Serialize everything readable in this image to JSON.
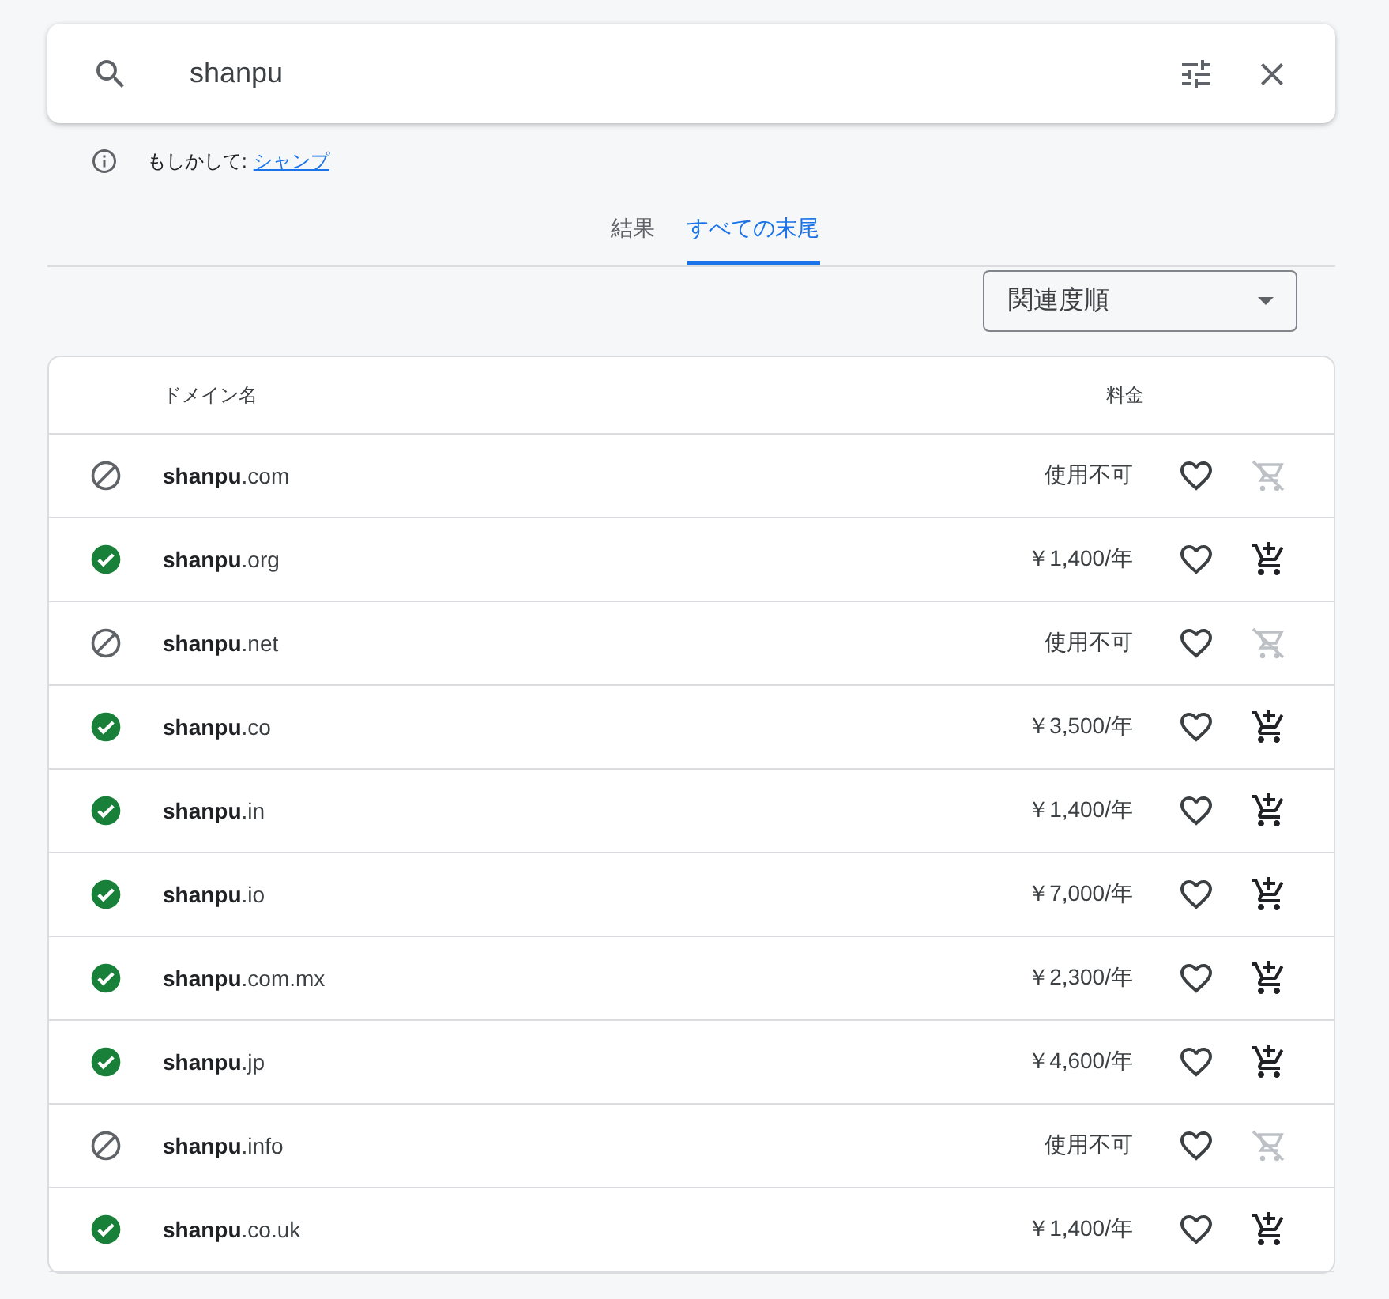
{
  "search": {
    "value": "shanpu"
  },
  "suggestion": {
    "label": "もしかして:",
    "link": "シャンプ"
  },
  "tabs": [
    {
      "label": "結果",
      "selected": false
    },
    {
      "label": "すべての末尾",
      "selected": true
    }
  ],
  "sort": {
    "value": "関連度順"
  },
  "table": {
    "columns": [
      "ドメイン名",
      "料金"
    ],
    "rows": [
      {
        "domain": "**shanpu**.com",
        "price": "使用不可",
        "available": false
      },
      {
        "domain": "**shanpu**.org",
        "price": "￥1,400/年",
        "available": true
      },
      {
        "domain": "**shanpu**.net",
        "price": "使用不可",
        "available": false
      },
      {
        "domain": "**shanpu**.co",
        "price": "￥3,500/年",
        "available": true
      },
      {
        "domain": "**shanpu**.in",
        "price": "￥1,400/年",
        "available": true
      },
      {
        "domain": "**shanpu**.io",
        "price": "￥7,000/年",
        "available": true
      },
      {
        "domain": "**shanpu**.com.mx",
        "price": "￥2,300/年",
        "available": true
      },
      {
        "domain": "**shanpu**.jp",
        "price": "￥4,600/年",
        "available": true
      },
      {
        "domain": "**shanpu**.info",
        "price": "使用不可",
        "available": false
      },
      {
        "domain": "**shanpu**.co.uk",
        "price": "￥1,400/年",
        "available": true
      }
    ]
  }
}
